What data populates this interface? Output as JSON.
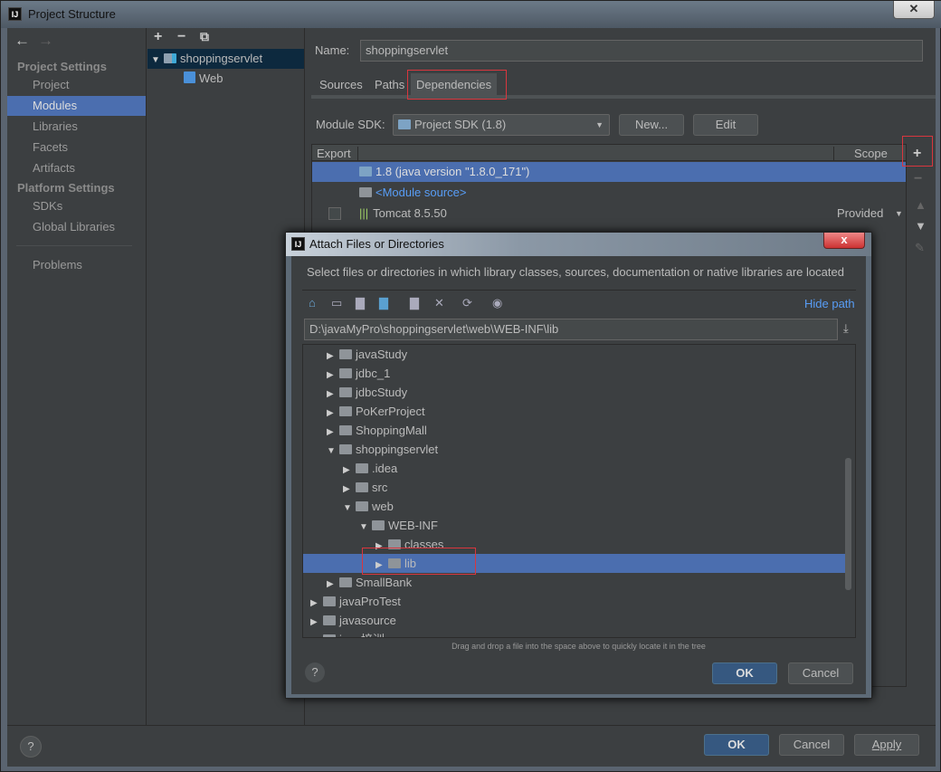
{
  "window": {
    "title": "Project Structure",
    "close": "✕"
  },
  "sidebar": {
    "back": "←",
    "forward": "→",
    "sections": [
      {
        "label": "Project Settings",
        "items": [
          "Project",
          "Modules",
          "Libraries",
          "Facets",
          "Artifacts"
        ]
      },
      {
        "label": "Platform Settings",
        "items": [
          "SDKs",
          "Global Libraries"
        ]
      }
    ],
    "problems": "Problems",
    "selected": "Modules"
  },
  "modules": {
    "toolbar": [
      "+",
      "−",
      "⧉"
    ],
    "tree": [
      {
        "label": "shoppingservlet",
        "expanded": true
      },
      {
        "label": "Web"
      }
    ]
  },
  "main": {
    "name_label": "Name:",
    "name_value": "shoppingservlet",
    "tabs": [
      "Sources",
      "Paths",
      "Dependencies"
    ],
    "active_tab": "Dependencies",
    "sdk_label": "Module SDK:",
    "sdk_value": "Project SDK (1.8)",
    "new_label": "New...",
    "edit_label": "Edit",
    "table": {
      "headers": [
        "Export",
        "Scope"
      ],
      "rows": [
        {
          "name": "1.8 (java version \"1.8.0_171\")",
          "scope": "",
          "selected": true
        },
        {
          "name": "<Module source>",
          "scope": ""
        },
        {
          "name": "Tomcat 8.5.50",
          "scope": "Provided",
          "checkbox": true
        }
      ]
    },
    "side_tools": [
      "+",
      "−",
      "▲",
      "▼",
      "✎"
    ]
  },
  "bottom": {
    "help": "?",
    "ok": "OK",
    "cancel": "Cancel",
    "apply": "Apply"
  },
  "dialog": {
    "title": "Attach Files or Directories",
    "close": "x",
    "description": "Select files or directories in which library classes, sources, documentation or native libraries are located",
    "toolbar": [
      "home-icon",
      "desktop-icon",
      "project-folder-icon",
      "module-folder-icon",
      "new-folder-icon",
      "delete-icon",
      "refresh-icon",
      "show-hidden-icon"
    ],
    "hide_path": "Hide path",
    "path": "D:\\javaMyPro\\shoppingservlet\\web\\WEB-INF\\lib",
    "tree": [
      {
        "label": "javaStudy",
        "level": 2,
        "expanded": false
      },
      {
        "label": "jdbc_1",
        "level": 2,
        "expanded": false
      },
      {
        "label": "jdbcStudy",
        "level": 2,
        "expanded": false
      },
      {
        "label": "PoKerProject",
        "level": 2,
        "expanded": false
      },
      {
        "label": "ShoppingMall",
        "level": 2,
        "expanded": false
      },
      {
        "label": "shoppingservlet",
        "level": 2,
        "expanded": true
      },
      {
        "label": ".idea",
        "level": 3,
        "expanded": false
      },
      {
        "label": "src",
        "level": 3,
        "expanded": false
      },
      {
        "label": "web",
        "level": 3,
        "expanded": true
      },
      {
        "label": "WEB-INF",
        "level": 4,
        "expanded": true
      },
      {
        "label": "classes",
        "level": 5,
        "expanded": false
      },
      {
        "label": "lib",
        "level": 5,
        "expanded": false,
        "selected": true
      },
      {
        "label": "SmallBank",
        "level": 2,
        "expanded": false
      },
      {
        "label": "javaProTest",
        "level": 1,
        "expanded": false
      },
      {
        "label": "javasource",
        "level": 1,
        "expanded": false
      },
      {
        "label": "java培训",
        "level": 1,
        "expanded": false
      }
    ],
    "hint": "Drag and drop a file into the space above to quickly locate it in the tree",
    "help": "?",
    "ok": "OK",
    "cancel": "Cancel"
  },
  "colors": {
    "selection": "#4b6eaf",
    "background": "#3c3f41",
    "link": "#589df6",
    "highlight_box": "#d9363e"
  }
}
